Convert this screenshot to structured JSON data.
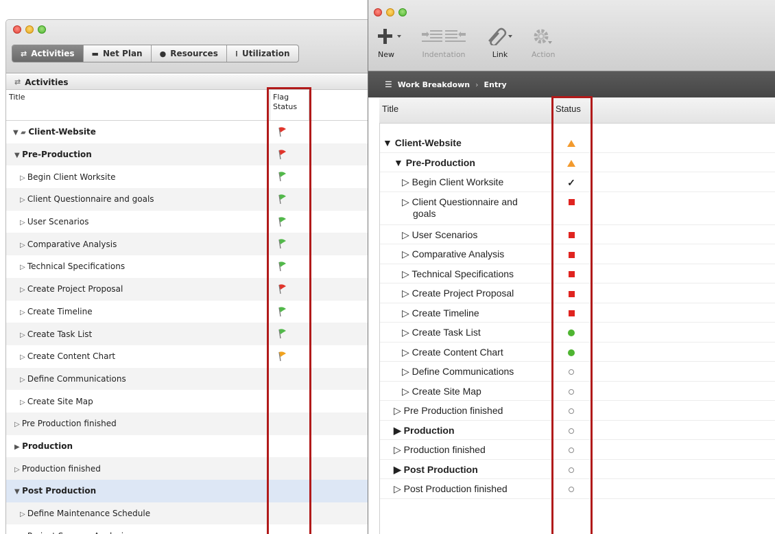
{
  "left_window": {
    "tabs": [
      {
        "label": "Activities",
        "icon": "arrows-icon"
      },
      {
        "label": "Net Plan",
        "icon": "netplan-icon"
      },
      {
        "label": "Resources",
        "icon": "person-icon"
      },
      {
        "label": "Utilization",
        "icon": "bars-icon"
      }
    ],
    "header_title": "Activities",
    "col_title": "Title",
    "col_flag_line1": "Flag",
    "col_flag_line2": "Status",
    "rows": [
      {
        "label": "Client-Website",
        "flag": "red"
      },
      {
        "label": "Pre-Production",
        "flag": "red"
      },
      {
        "label": "Begin Client Worksite",
        "flag": "green"
      },
      {
        "label": "Client Questionnaire and goals",
        "flag": "green"
      },
      {
        "label": "User Scenarios",
        "flag": "green"
      },
      {
        "label": "Comparative Analysis",
        "flag": "green"
      },
      {
        "label": "Technical Specifications",
        "flag": "green"
      },
      {
        "label": "Create Project Proposal",
        "flag": "red"
      },
      {
        "label": "Create Timeline",
        "flag": "green"
      },
      {
        "label": "Create Task List",
        "flag": "green"
      },
      {
        "label": "Create Content Chart",
        "flag": "orange"
      },
      {
        "label": "Define Communications",
        "flag": ""
      },
      {
        "label": "Create Site Map",
        "flag": ""
      },
      {
        "label": "Pre Production finished",
        "flag": ""
      },
      {
        "label": "Production",
        "flag": ""
      },
      {
        "label": "Production finished",
        "flag": ""
      },
      {
        "label": "Post Production",
        "flag": ""
      },
      {
        "label": "Define Maintenance Schedule",
        "flag": ""
      },
      {
        "label": "Project Success Analysis",
        "flag": ""
      }
    ]
  },
  "right_window": {
    "toolbar": {
      "new_label": "New",
      "indentation_label": "Indentation",
      "link_label": "Link",
      "action_label": "Action"
    },
    "breadcrumb": {
      "parent": "Work Breakdown",
      "current": "Entry"
    },
    "col_title": "Title",
    "col_status": "Status",
    "rows": [
      {
        "label": "Client-Website",
        "status": "warning"
      },
      {
        "label": "Pre-Production",
        "status": "warning"
      },
      {
        "label": "Begin Client Worksite",
        "status": "done"
      },
      {
        "label": "Client Questionnaire and goals",
        "status": "red"
      },
      {
        "label": "User Scenarios",
        "status": "red"
      },
      {
        "label": "Comparative Analysis",
        "status": "red"
      },
      {
        "label": "Technical Specifications",
        "status": "red"
      },
      {
        "label": "Create Project Proposal",
        "status": "red"
      },
      {
        "label": "Create Timeline",
        "status": "red"
      },
      {
        "label": "Create Task List",
        "status": "green"
      },
      {
        "label": "Create Content Chart",
        "status": "green"
      },
      {
        "label": "Define Communications",
        "status": "open"
      },
      {
        "label": "Create Site Map",
        "status": "open"
      },
      {
        "label": "Pre Production finished",
        "status": "open"
      },
      {
        "label": "Production",
        "status": "open"
      },
      {
        "label": "Production finished",
        "status": "open"
      },
      {
        "label": "Post Production",
        "status": "open"
      },
      {
        "label": "Post Production finished",
        "status": "open"
      }
    ]
  },
  "colors": {
    "flag_red": "#e0352b",
    "flag_green": "#52b84a",
    "flag_orange": "#f0a21f",
    "highlight": "#b11a1a"
  }
}
